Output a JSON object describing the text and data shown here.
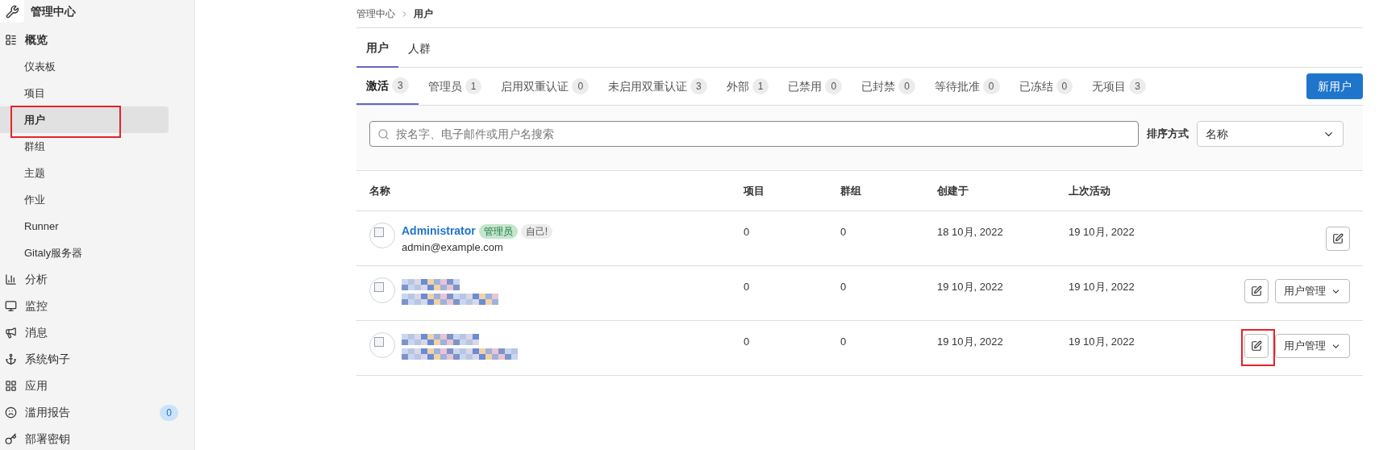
{
  "sidebar": {
    "title": "管理中心",
    "sections": [
      {
        "label": "概览",
        "children": [
          {
            "label": "仪表板",
            "selected": false,
            "highlighted": false
          },
          {
            "label": "项目",
            "selected": false,
            "highlighted": false
          },
          {
            "label": "用户",
            "selected": true,
            "highlighted": true
          },
          {
            "label": "群组",
            "selected": false,
            "highlighted": false
          },
          {
            "label": "主题",
            "selected": false,
            "highlighted": false
          },
          {
            "label": "作业",
            "selected": false,
            "highlighted": false
          },
          {
            "label": "Runner",
            "selected": false,
            "highlighted": false
          },
          {
            "label": "Gitaly服务器",
            "selected": false,
            "highlighted": false
          }
        ]
      },
      {
        "label": "分析"
      },
      {
        "label": "监控"
      },
      {
        "label": "消息"
      },
      {
        "label": "系统钩子"
      },
      {
        "label": "应用"
      },
      {
        "label": "滥用报告",
        "badge": "0"
      },
      {
        "label": "部署密钥"
      }
    ]
  },
  "breadcrumb": [
    "管理中心",
    "用户"
  ],
  "tabs": [
    {
      "label": "用户",
      "selected": true
    },
    {
      "label": "人群",
      "selected": false
    }
  ],
  "filters": [
    {
      "label": "激活",
      "count": "3",
      "selected": true
    },
    {
      "label": "管理员",
      "count": "1",
      "selected": false
    },
    {
      "label": "启用双重认证",
      "count": "0",
      "selected": false
    },
    {
      "label": "未启用双重认证",
      "count": "3",
      "selected": false
    },
    {
      "label": "外部",
      "count": "1",
      "selected": false
    },
    {
      "label": "已禁用",
      "count": "0",
      "selected": false
    },
    {
      "label": "已封禁",
      "count": "0",
      "selected": false
    },
    {
      "label": "等待批准",
      "count": "0",
      "selected": false
    },
    {
      "label": "已冻结",
      "count": "0",
      "selected": false
    },
    {
      "label": "无项目",
      "count": "3",
      "selected": false
    }
  ],
  "new_user_button": "新用户",
  "search": {
    "placeholder": "按名字、电子邮件或用户名搜索"
  },
  "sort": {
    "label": "排序方式",
    "value": "名称"
  },
  "table": {
    "columns": [
      "名称",
      "项目",
      "群组",
      "创建于",
      "上次活动"
    ],
    "rows": [
      {
        "redacted": false,
        "name": "Administrator",
        "badges": [
          {
            "label": "管理员",
            "kind": "admin"
          },
          {
            "label": "自己!",
            "kind": "self"
          }
        ],
        "email": "admin@example.com",
        "projects": "0",
        "groups": "0",
        "created": "18 10月, 2022",
        "last_activity": "19 10月, 2022",
        "edit_highlighted": false
      },
      {
        "redacted": true,
        "projects": "0",
        "groups": "0",
        "created": "19 10月, 2022",
        "last_activity": "19 10月, 2022",
        "manage": "用户管理",
        "edit_highlighted": false
      },
      {
        "redacted": true,
        "projects": "0",
        "groups": "0",
        "created": "19 10月, 2022",
        "last_activity": "19 10月, 2022",
        "manage": "用户管理",
        "edit_highlighted": true
      }
    ]
  }
}
